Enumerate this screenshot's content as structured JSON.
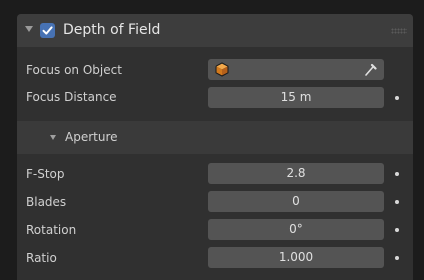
{
  "panel": {
    "title": "Depth of Field",
    "enabled": true,
    "accent_color": "#4772b3"
  },
  "focus": {
    "object_label": "Focus on Object",
    "object_value": "",
    "object_icon": "object-cube-icon",
    "picker_icon": "eyedropper-icon",
    "distance_label": "Focus Distance",
    "distance_value": "15 m"
  },
  "aperture": {
    "title": "Aperture",
    "fstop_label": "F-Stop",
    "fstop_value": "2.8",
    "blades_label": "Blades",
    "blades_value": "0",
    "rotation_label": "Rotation",
    "rotation_value": "0°",
    "ratio_label": "Ratio",
    "ratio_value": "1.000"
  }
}
